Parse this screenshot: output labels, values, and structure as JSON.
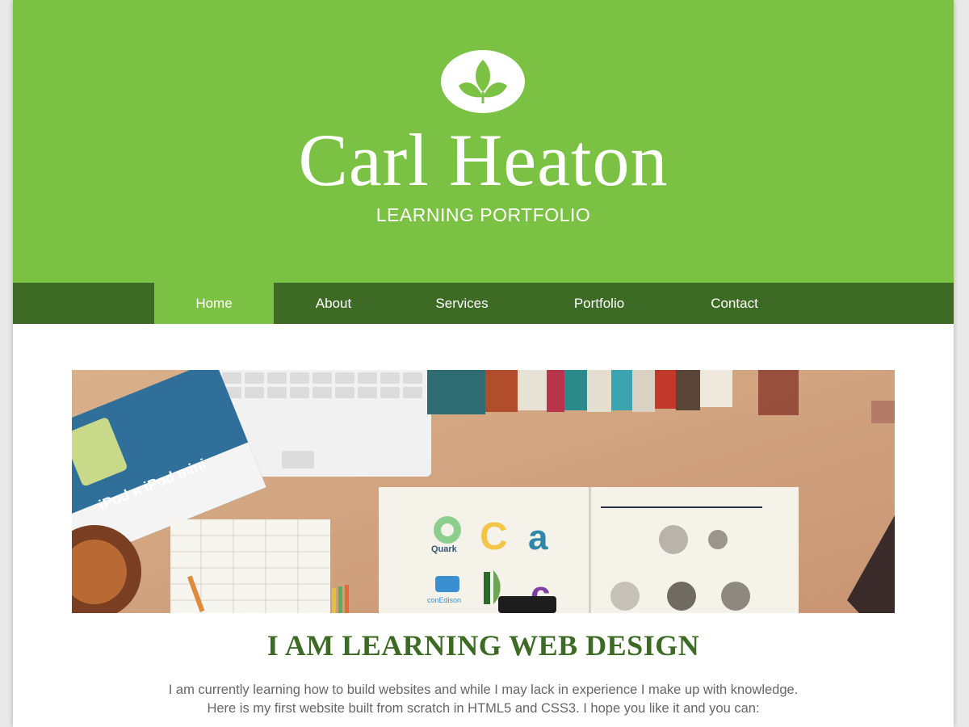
{
  "header": {
    "title": "Carl Heaton",
    "subtitle": "LEARNING PORTFOLIO",
    "logo_icon": "leaf-circle-icon",
    "background": "#7bc143"
  },
  "nav": {
    "background": "#3d6b25",
    "active_color": "#7bc143",
    "items": [
      {
        "label": "Home",
        "active": true
      },
      {
        "label": "About",
        "active": false
      },
      {
        "label": "Services",
        "active": false
      },
      {
        "label": "Portfolio",
        "active": false
      },
      {
        "label": "Contact",
        "active": false
      }
    ]
  },
  "hero": {
    "logos": [
      "Quark",
      "conEdison"
    ],
    "brochure_text": "iPod и iPod mini"
  },
  "main": {
    "headline": "I AM LEARNING WEB DESIGN",
    "intro_line1": "I am currently learning how to build websites and while I may lack in experience I make up with knowledge.",
    "intro_line2": "Here is my first website built from scratch in HTML5 and CSS3. I hope you like it and you can:"
  }
}
